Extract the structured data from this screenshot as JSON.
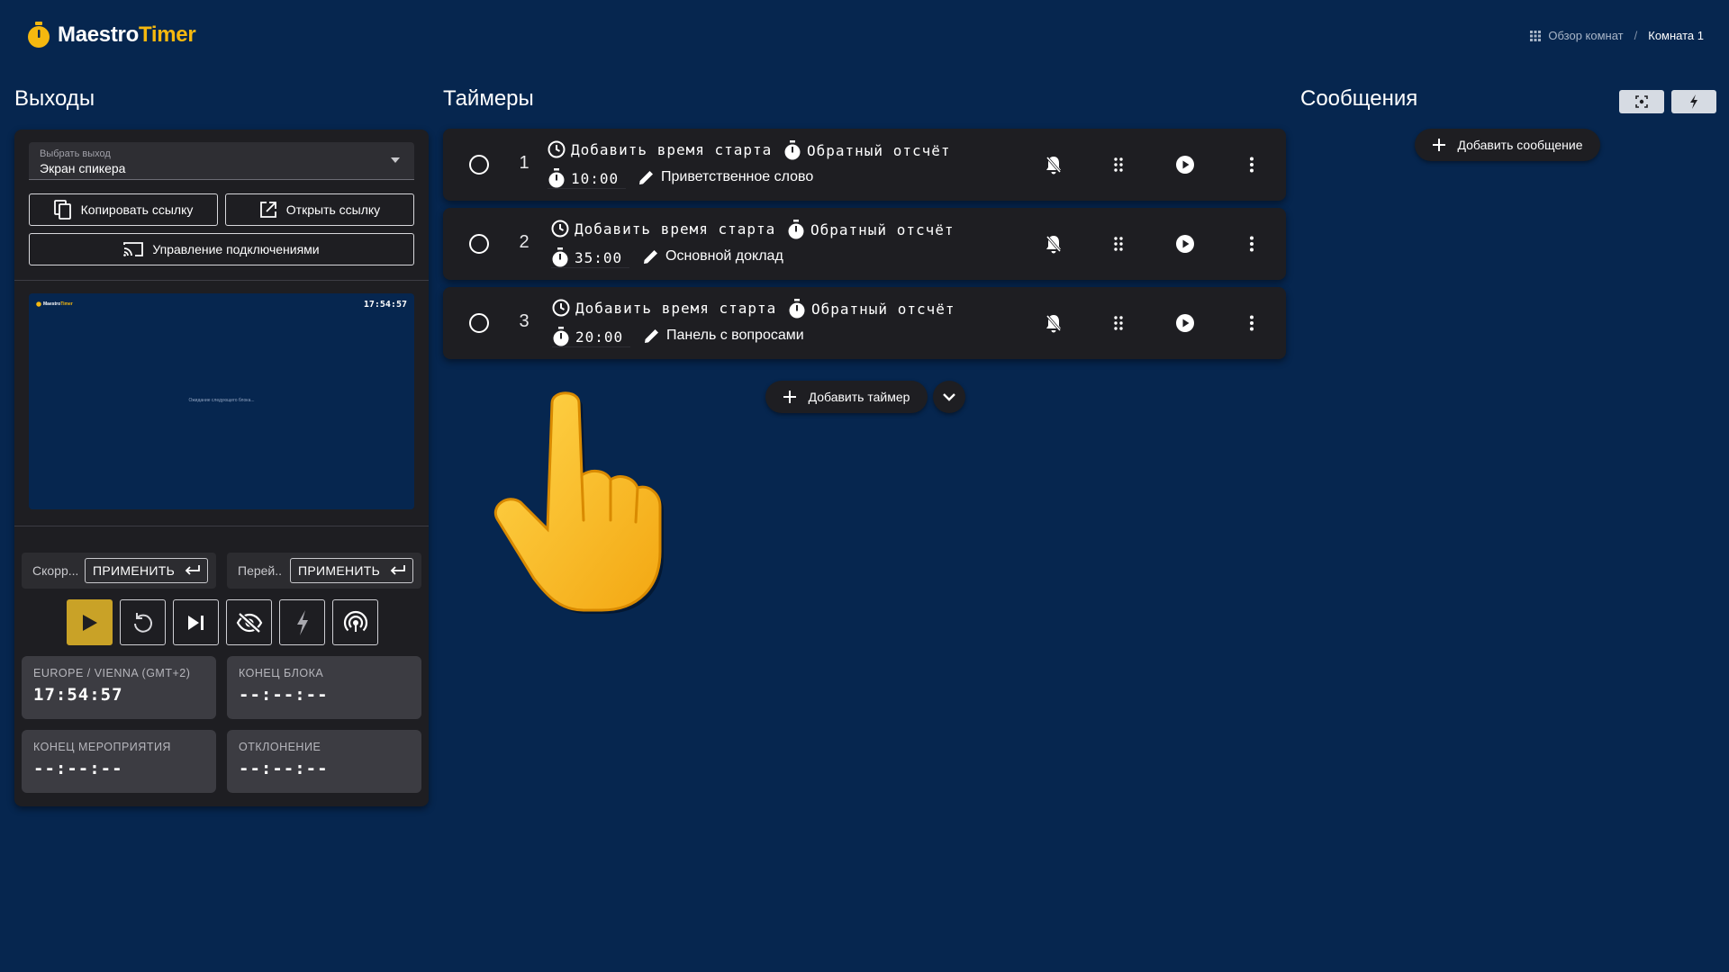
{
  "brand": {
    "name_part1": "Maestro",
    "name_part2": "Timer"
  },
  "breadcrumb": {
    "overview": "Обзор комнат",
    "separator": "/",
    "current": "Комната 1"
  },
  "sections": {
    "outputs": "Выходы",
    "timers": "Таймеры",
    "messages": "Сообщения"
  },
  "outputs": {
    "select_label": "Выбрать выход",
    "select_value": "Экран спикера",
    "copy_link": "Копировать ссылку",
    "open_link": "Открыть ссылку",
    "manage_connections": "Управление подключениями",
    "preview": {
      "clock": "17:54:57",
      "brand_part1": "Maestro",
      "brand_part2": "Timer",
      "message": "Ожидание следующего блока..."
    },
    "speed": {
      "label": "Скорр...",
      "apply": "ПРИМЕНИТЬ"
    },
    "jump": {
      "label": "Перей...",
      "apply": "ПРИМЕНИТЬ"
    },
    "controls": [
      "play-icon",
      "reset-icon",
      "skip-next-icon",
      "visibility-off-icon",
      "flash-icon",
      "broadcast-icon"
    ],
    "info": {
      "tz_label": "EUROPE / VIENNA (GMT+2)",
      "tz_value": "17:54:57",
      "block_end_label": "КОНЕЦ БЛОКА",
      "block_end_value": "--:--:--",
      "event_end_label": "КОНЕЦ МЕРОПРИЯТИЯ",
      "event_end_value": "--:--:--",
      "deviation_label": "ОТКЛОНЕНИЕ",
      "deviation_value": "--:--:--"
    }
  },
  "timers": [
    {
      "number": "1",
      "start": "Добавить время старта",
      "mode": "Обратный отсчёт",
      "duration": "10:00",
      "title": "Приветственное слово"
    },
    {
      "number": "2",
      "start": "Добавить время старта",
      "mode": "Обратный отсчёт",
      "duration": "35:00",
      "title": "Основной доклад"
    },
    {
      "number": "3",
      "start": "Добавить время старта",
      "mode": "Обратный отсчёт",
      "duration": "20:00",
      "title": "Панель с вопросами"
    }
  ],
  "add_timer": "Добавить таймер",
  "messages": {
    "add": "Добавить сообщение"
  },
  "colors": {
    "background": "#06264f",
    "panel": "#1e1e22",
    "accent": "#f5b80f",
    "active_control": "#c9a227"
  }
}
